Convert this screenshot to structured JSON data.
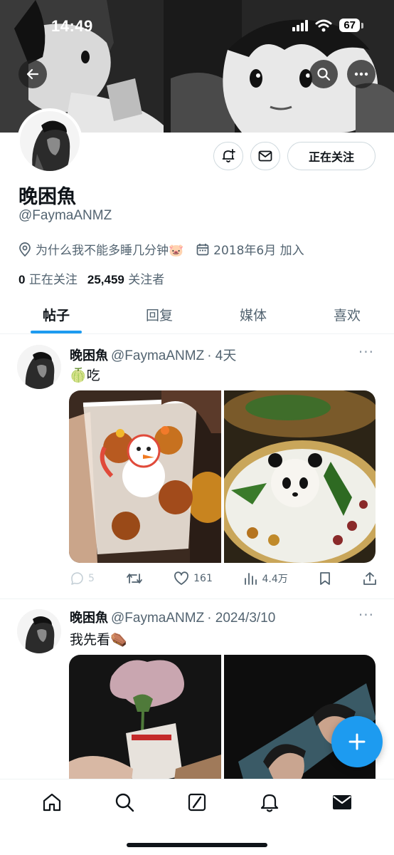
{
  "status_bar": {
    "time": "14:49",
    "battery": "67"
  },
  "profile": {
    "name": "晚困魚",
    "handle": "@FaymaANMZ",
    "bio_location": "为什么我不能多睡几分钟🐷",
    "joined": "2018年6月 加入",
    "following_count": "0",
    "following_label": "正在关注",
    "followers_count": "25,459",
    "followers_label": "关注者",
    "follow_button": "正在关注"
  },
  "tabs": [
    {
      "label": "帖子",
      "active": true
    },
    {
      "label": "回复",
      "active": false
    },
    {
      "label": "媒体",
      "active": false
    },
    {
      "label": "喜欢",
      "active": false
    }
  ],
  "posts": [
    {
      "name": "晚困魚",
      "handle": "@FaymaANMZ",
      "time": "· 4天",
      "text": "🍈吃",
      "replies": "5",
      "retweets": "",
      "likes": "161",
      "views": "4.4万"
    },
    {
      "name": "晚困魚",
      "handle": "@FaymaANMZ",
      "time": "· 2024/3/10",
      "text": "我先看⚰️"
    }
  ],
  "colors": {
    "accent": "#1d9bf0",
    "text_primary": "#0f1419",
    "text_secondary": "#536471",
    "border": "#cfd9de"
  },
  "icons": {
    "back": "arrow-left-icon",
    "search": "search-icon",
    "more": "more-icon",
    "notify": "bell-plus-icon",
    "message": "mail-icon",
    "location": "location-icon",
    "calendar": "calendar-icon",
    "compose": "plus-icon"
  }
}
